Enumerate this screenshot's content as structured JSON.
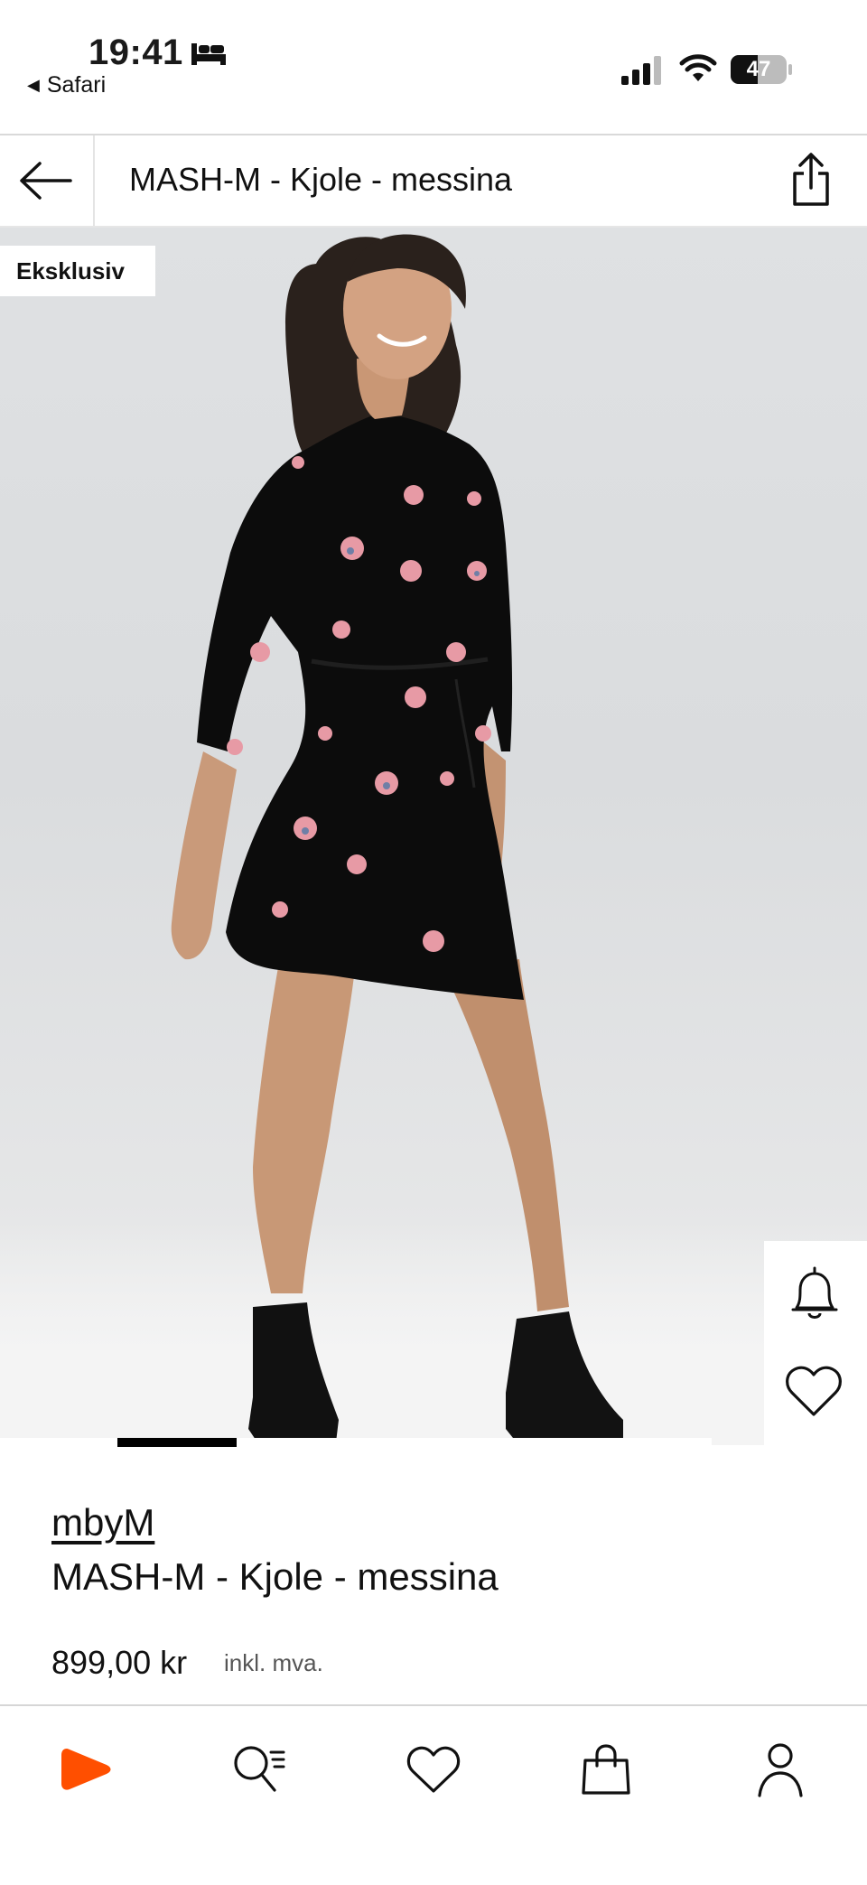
{
  "status_bar": {
    "time": "19:41",
    "back_app": "Safari",
    "battery_level": "47",
    "icons": [
      "bed-icon",
      "signal-icon",
      "wifi-icon",
      "battery-icon"
    ]
  },
  "header": {
    "title": "MASH-M - Kjole - messina",
    "back_icon": "arrow-left-icon",
    "share_icon": "share-icon"
  },
  "gallery": {
    "badge": "Eksklusiv",
    "active_index_fraction": 0.17,
    "side_actions": [
      "bell-icon",
      "heart-icon"
    ]
  },
  "product": {
    "brand": "mbyM",
    "name": "MASH-M - Kjole - messina",
    "price": "899,00 kr",
    "tax_note": "inkl. mva."
  },
  "bottom_nav": {
    "items": [
      "home-icon",
      "search-icon",
      "wishlist-icon",
      "bag-icon",
      "profile-icon"
    ],
    "accent": "#ff4f00"
  }
}
